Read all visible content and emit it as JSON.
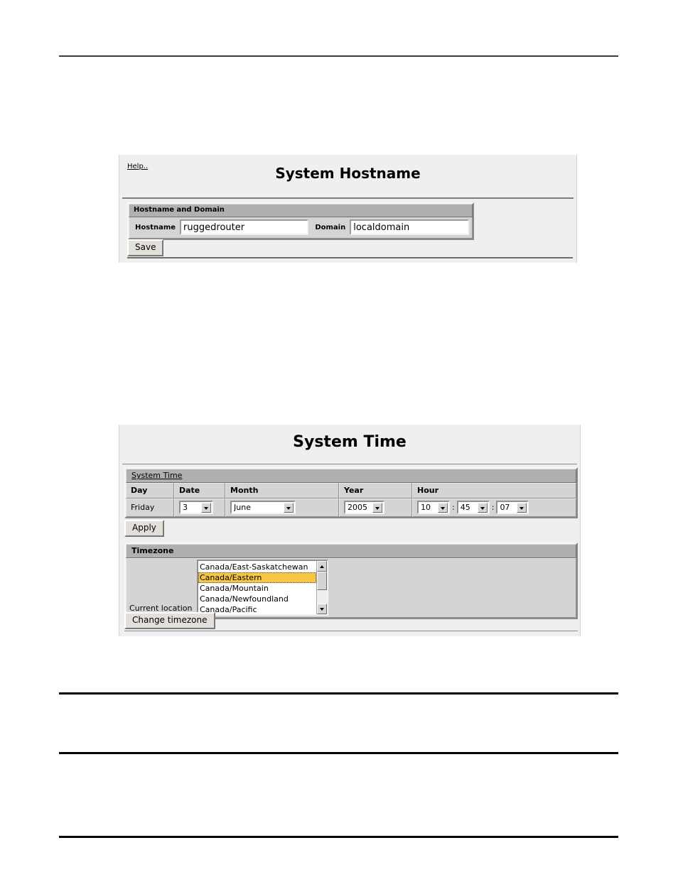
{
  "hostname_panel": {
    "help_link": "Help..",
    "title": "System Hostname",
    "section_header": "Hostname and Domain",
    "hostname_label": "Hostname",
    "hostname_value": "ruggedrouter",
    "domain_label": "Domain",
    "domain_value": "localdomain",
    "save_label": "Save"
  },
  "time_panel": {
    "title": "System Time",
    "section_header": "System Time",
    "columns": [
      "Day",
      "Date",
      "Month",
      "Year",
      "Hour"
    ],
    "day_value": "Friday",
    "date_value": "3",
    "month_value": "June",
    "year_value": "2005",
    "hour_value": "10",
    "minute_value": "45",
    "second_value": "07",
    "time_separator": ":",
    "apply_label": "Apply",
    "timezone_header": "Timezone",
    "current_location_label": "Current location",
    "timezone_options": [
      "Canada/East-Saskatchewan",
      "Canada/Eastern",
      "Canada/Mountain",
      "Canada/Newfoundland",
      "Canada/Pacific"
    ],
    "timezone_selected": "Canada/Eastern",
    "change_timezone_label": "Change timezone",
    "scroll_up_icon": "scroll-up-arrow-icon",
    "scroll_down_icon": "scroll-down-arrow-icon"
  },
  "colors": {
    "page_background": "#ffffff",
    "card_background": "#efefef",
    "section_header": "#b0b0b0",
    "table_background": "#d4d4d4",
    "selection_highlight": "#f6c746",
    "rule": "#000000"
  }
}
